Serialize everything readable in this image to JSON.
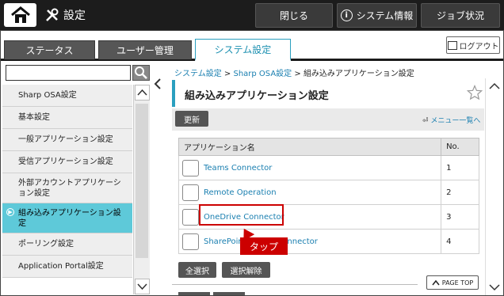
{
  "header": {
    "title": "設定",
    "close_label": "閉じる",
    "sysinfo_label": "システム情報",
    "job_label": "ジョブ状況"
  },
  "tabs": [
    {
      "label": "ステータス"
    },
    {
      "label": "ユーザー管理"
    },
    {
      "label": "システム設定",
      "active": true
    }
  ],
  "logout_label": "ログアウト",
  "sidebar": {
    "search_value": "",
    "items": [
      {
        "label": "Sharp OSA設定"
      },
      {
        "label": "基本設定"
      },
      {
        "label": "一般アプリケーション設定"
      },
      {
        "label": "受信アプリケーション設定"
      },
      {
        "label": "外部アカウントアプリケーション設定"
      },
      {
        "label": "組み込みアプリケーション設定",
        "active": true
      },
      {
        "label": "ポーリング設定"
      },
      {
        "label": "Application Portal設定"
      }
    ]
  },
  "breadcrumb": {
    "item1": "システム設定",
    "sep": ">",
    "item2": "Sharp OSA設定",
    "item3": "組み込みアプリケーション設定"
  },
  "panel": {
    "title": "組み込みアプリケーション設定",
    "refresh_label": "更新",
    "menu_list_label": "メニュー一覧へ"
  },
  "table": {
    "col_name": "アプリケーション名",
    "col_no": "No.",
    "rows": [
      {
        "name": "Teams Connector",
        "no": "1"
      },
      {
        "name": "Remote Operation",
        "no": "2"
      },
      {
        "name": "OneDrive Connector",
        "no": "3"
      },
      {
        "name": "SharePoint Online Connector",
        "no": "4"
      }
    ]
  },
  "callout": {
    "label": "タップ"
  },
  "buttons": {
    "select_all": "全選択",
    "deselect": "選択解除",
    "page_top": "PAGE TOP"
  },
  "colors": {
    "accent": "#2a9fbf",
    "active_item": "#5ec9d9",
    "callout": "#cc0000"
  }
}
